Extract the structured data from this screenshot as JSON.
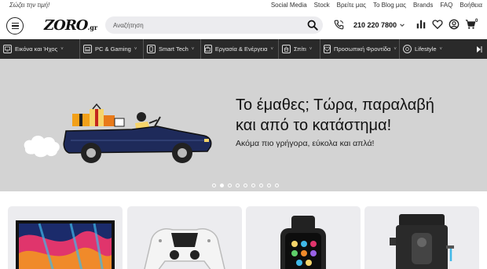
{
  "topbar": {
    "tagline": "Σώζει την τιμή!",
    "links": [
      "Social Media",
      "Stock",
      "Βρείτε μας",
      "Το Blog μας",
      "Brands",
      "FAQ",
      "Βοήθεια"
    ]
  },
  "header": {
    "logo_text": "ZORO",
    "logo_suffix": ".gr",
    "search_placeholder": "Αναζήτηση",
    "phone": "210 220 7800",
    "cart_count": "0"
  },
  "nav": {
    "items": [
      {
        "label": "Εικόνα και Ήχος",
        "icon": "tv-icon"
      },
      {
        "label": "PC & Gaming",
        "icon": "laptop-icon"
      },
      {
        "label": "Smart Tech",
        "icon": "smartphone-icon"
      },
      {
        "label": "Εργασία & Ενέργεια",
        "icon": "briefcase-icon"
      },
      {
        "label": "Σπίτι",
        "icon": "house-icon"
      },
      {
        "label": "Προσωπική Φροντίδα",
        "icon": "heart-icon"
      },
      {
        "label": "Lifestyle",
        "icon": "lifestyle-icon"
      }
    ]
  },
  "banner": {
    "title_line1": "Το έμαθες; Τώρα, παραλαβή",
    "title_line2": "και από το κατάστημα!",
    "subtitle": "Ακόμα πιο γρήγορα, εύκολα και απλά!",
    "slide_count": 9,
    "active_slide": 2
  },
  "colors": {
    "nav_bg": "#2a2a2a",
    "banner_bg": "#d3d3d3",
    "car_body": "#1e2a5a",
    "card_bg": "#ececef"
  }
}
